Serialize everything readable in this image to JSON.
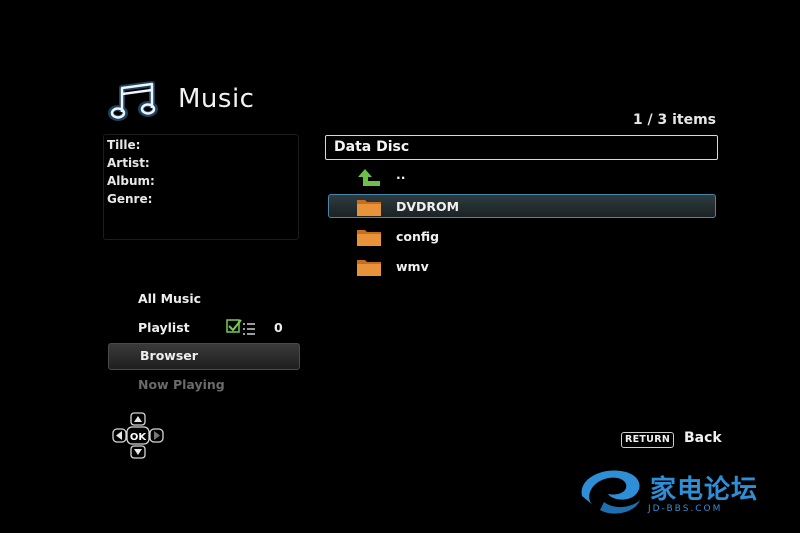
{
  "header": {
    "title": "Music",
    "icon": "music-note-icon",
    "item_count": "1 / 3 items"
  },
  "info": {
    "title_label": "Tille:",
    "artist_label": "Artist:",
    "album_label": "Album:",
    "genre_label": "Genre:"
  },
  "menu": {
    "items": [
      {
        "label": "All Music"
      },
      {
        "label": "Playlist",
        "count": "0"
      },
      {
        "label": "Browser",
        "selected": true
      },
      {
        "label": "Now Playing",
        "disabled": true
      }
    ]
  },
  "browser": {
    "path": "Data Disc",
    "up_label": "..",
    "items": [
      {
        "name": "DVDROM",
        "selected": true
      },
      {
        "name": "config"
      },
      {
        "name": "wmv"
      }
    ]
  },
  "nav": {
    "dpad_center": "OK",
    "return_key": "RETURN",
    "return_label": "Back"
  },
  "watermark": {
    "text": "家电论坛",
    "sub": "JD-BBS.COM"
  },
  "colors": {
    "background": "#000000",
    "selection_border": "#4a86a8",
    "folder": "#e8933a",
    "up_arrow": "#6cc04a",
    "icon_glow": "#5fb8ff",
    "watermark": "#2f8fd6"
  }
}
